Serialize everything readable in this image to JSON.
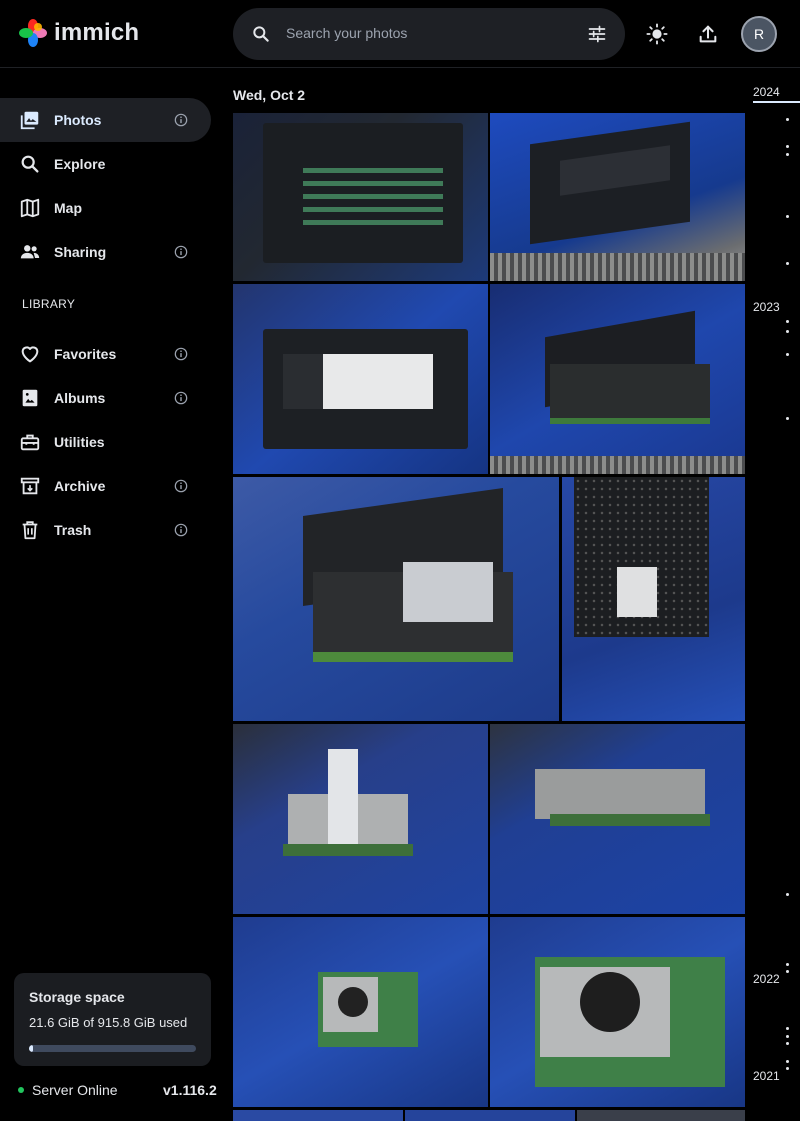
{
  "app": {
    "name": "immich"
  },
  "search": {
    "placeholder": "Search your photos"
  },
  "user": {
    "initial": "R"
  },
  "sidebar": {
    "items": [
      {
        "label": "Photos"
      },
      {
        "label": "Explore"
      },
      {
        "label": "Map"
      },
      {
        "label": "Sharing"
      }
    ],
    "library_label": "LIBRARY",
    "library_items": [
      {
        "label": "Favorites"
      },
      {
        "label": "Albums"
      },
      {
        "label": "Utilities"
      },
      {
        "label": "Archive"
      },
      {
        "label": "Trash"
      }
    ]
  },
  "storage": {
    "title": "Storage space",
    "used_text": "21.6 GiB of 915.8 GiB used",
    "used_fraction": 0.024
  },
  "server": {
    "status": "Server Online",
    "version": "v1.116.2"
  },
  "timeline": {
    "date_group": "Wed, Oct 2",
    "years": [
      "2024",
      "2023",
      "2022",
      "2021"
    ]
  },
  "colors": {
    "accent": "#dbeafe",
    "online": "#22c55e",
    "background": "#000000",
    "panel": "#1e2025"
  }
}
